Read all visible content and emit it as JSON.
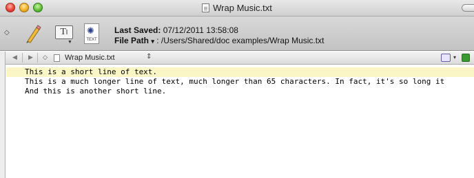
{
  "window": {
    "title": "Wrap Music.txt"
  },
  "toolbar": {
    "last_saved_label": "Last Saved:",
    "last_saved_value": "07/12/2011 13:58:08",
    "file_path_label": "File Path",
    "file_path_caret": "▾",
    "file_path_value": ": /Users/Shared/doc examples/Wrap Music.txt",
    "textformat_glyph": "T",
    "textfile_label": "TEXT"
  },
  "navbar": {
    "back": "◀",
    "forward": "▶",
    "marker": "◇",
    "file_name": "Wrap Music.txt",
    "file_selector": "⇕"
  },
  "editor": {
    "lines": [
      "This is a short line of text.",
      "This is a much longer line of text, much longer than 65 characters. In fact, it's so long it",
      "And this is another short line."
    ]
  },
  "colors": {
    "current_line": "#fbf6c5",
    "toolbar_top": "#d9d9d9",
    "toolbar_bottom": "#c3c3c3"
  },
  "icons": [
    "close-button-icon",
    "minimize-button-icon",
    "zoom-button-icon",
    "pencil-icon",
    "text-format-icon",
    "text-file-icon",
    "document-icon",
    "bookmark-icon",
    "green-square-icon"
  ]
}
